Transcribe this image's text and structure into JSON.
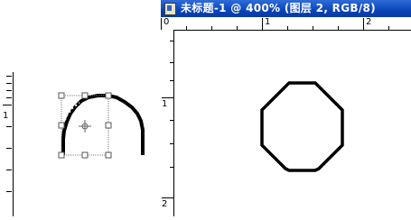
{
  "document_window": {
    "title": "未标题-1 @ 400% (图层 2, RGB/8)",
    "icon": "photoshop-document-icon"
  },
  "top_ruler": {
    "labels": [
      "0",
      "1",
      "2"
    ]
  },
  "vertical_ruler": {
    "labels": [
      "1",
      "2"
    ]
  },
  "left_ruler": {
    "labels": [
      "1"
    ]
  },
  "tools": {
    "transform_center_icon": "crosshair-pivot-icon",
    "transform_handles": "square-handle-icon"
  }
}
